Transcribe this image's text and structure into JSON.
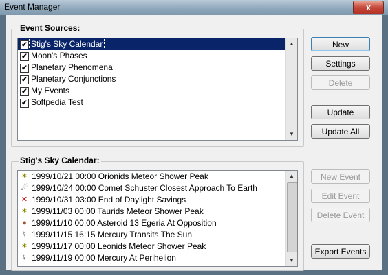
{
  "window": {
    "title": "Event Manager",
    "close": "x"
  },
  "sources": {
    "label": "Event Sources:",
    "items": [
      {
        "label": "Stig's Sky Calendar",
        "checked": true,
        "selected": true
      },
      {
        "label": "Moon's Phases",
        "checked": true
      },
      {
        "label": "Planetary Phenomena",
        "checked": true
      },
      {
        "label": "Planetary Conjunctions",
        "checked": true
      },
      {
        "label": "My Events",
        "checked": true
      },
      {
        "label": "Softpedia Test",
        "checked": true
      }
    ]
  },
  "buttons": {
    "new": "New",
    "settings": "Settings",
    "delete": "Delete",
    "update": "Update",
    "update_all": "Update All",
    "new_event": "New Event",
    "edit_event": "Edit Event",
    "delete_event": "Delete Event",
    "export_events": "Export Events"
  },
  "events": {
    "label": "Stig's Sky Calendar:",
    "items": [
      {
        "icon": "meteor-shower-icon",
        "glyph": "✶",
        "color": "#8a8a00",
        "text": "1999/10/21 00:00 Orionids Meteor Shower Peak"
      },
      {
        "icon": "comet-icon",
        "glyph": "☄",
        "color": "#333333",
        "text": "1999/10/24 00:00 Comet Schuster Closest Approach To Earth"
      },
      {
        "icon": "cross-icon",
        "glyph": "✕",
        "color": "#d00000",
        "text": "1999/10/31 03:00 End of Daylight Savings"
      },
      {
        "icon": "meteor-shower-icon",
        "glyph": "✶",
        "color": "#8a8a00",
        "text": "1999/11/03 00:00 Taurids Meteor Shower Peak"
      },
      {
        "icon": "asteroid-icon",
        "glyph": "●",
        "color": "#a0522d",
        "text": "1999/11/10 00:00 Asteroid 13 Egeria At Opposition"
      },
      {
        "icon": "mercury-icon",
        "glyph": "☿",
        "color": "#333333",
        "text": "1999/11/15 16:15 Mercury Transits The Sun"
      },
      {
        "icon": "meteor-shower-icon",
        "glyph": "✶",
        "color": "#8a8a00",
        "text": "1999/11/17 00:00 Leonids Meteor Shower Peak"
      },
      {
        "icon": "mercury-icon",
        "glyph": "☿",
        "color": "#333333",
        "text": "1999/11/19 00:00 Mercury At Perihelion"
      }
    ]
  }
}
